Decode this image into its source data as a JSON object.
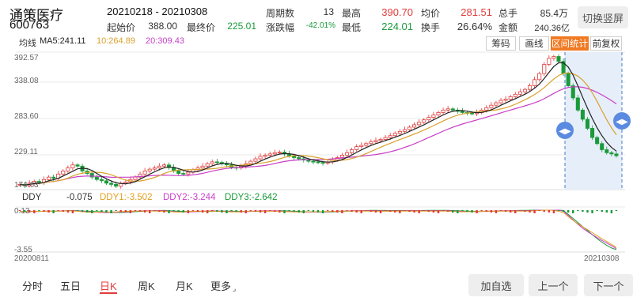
{
  "stock": {
    "name": "通策医疗",
    "code": "600763"
  },
  "summary": {
    "range": "20210218  - 20210308",
    "row1": [
      {
        "label": "周期数",
        "value": "13",
        "tone": "dark"
      },
      {
        "label": "最高",
        "value": "390.70",
        "tone": "red"
      },
      {
        "label": "均价",
        "value": "281.51",
        "tone": "red"
      },
      {
        "label": "总手",
        "value": "85.4万",
        "tone": "dark"
      }
    ],
    "row2": [
      {
        "label": "起始价",
        "value": "388.00",
        "tone": "dark"
      },
      {
        "label": "最终价",
        "value": "225.01",
        "tone": "green"
      },
      {
        "label": "涨跌幅",
        "value": "-42.01%",
        "tone": "green"
      },
      {
        "label": "最低",
        "value": "224.01",
        "tone": "green"
      },
      {
        "label": "换手",
        "value": "26.64%",
        "tone": "dark"
      },
      {
        "label": "金额",
        "value": "240.36亿",
        "tone": "dark"
      }
    ],
    "switch_label": "切换竖屏"
  },
  "ma": {
    "label": "均线",
    "ma5": "MA5:241.11",
    "ma10": "10:264.89",
    "ma20": "20:309.43",
    "colors": {
      "ma5": "#222222",
      "ma10": "#d9a12b",
      "ma20": "#c83fc8"
    }
  },
  "toolbar": [
    "筹码",
    "画线",
    "区间统计",
    "前复权"
  ],
  "toolbar_active": "区间统计",
  "price_axis": [
    "392.57",
    "338.08",
    "283.60",
    "229.11",
    "174.63"
  ],
  "ddy": {
    "name": "DDY",
    "value": "-0.075",
    "ddy1": "DDY1:-3.502",
    "ddy2": "DDY2:-3.244",
    "ddy3": "DDY3:-2.642",
    "axis_top": "0.13",
    "axis_bottom": "-3.55",
    "colors": {
      "ddy1": "#e0a020",
      "ddy2": "#c83fc8",
      "ddy3": "#1a9a3a"
    }
  },
  "dates": {
    "start": "20200811",
    "end": "20210308"
  },
  "tabs": [
    "分时",
    "五日",
    "日K",
    "周K",
    "月K",
    "更多"
  ],
  "tab_active": "日K",
  "buttons": {
    "add": "加自选",
    "prev": "上一个",
    "next": "下一个"
  },
  "chart_data": {
    "type": "candlestick",
    "x_start": "20200811",
    "x_end": "20210308",
    "ylim": [
      174.63,
      392.57
    ],
    "close_approx": [
      178,
      176,
      180,
      183,
      181,
      186,
      190,
      188,
      195,
      200,
      205,
      210,
      208,
      200,
      196,
      190,
      186,
      184,
      180,
      178,
      175,
      180,
      182,
      186,
      190,
      195,
      200,
      203,
      205,
      208,
      210,
      206,
      200,
      196,
      195,
      198,
      202,
      205,
      208,
      212,
      215,
      214,
      212,
      210,
      206,
      205,
      208,
      212,
      216,
      220,
      224,
      226,
      228,
      230,
      231,
      228,
      225,
      222,
      220,
      218,
      216,
      215,
      214,
      213,
      215,
      218,
      222,
      226,
      230,
      235,
      240,
      242,
      245,
      248,
      250,
      252,
      255,
      258,
      262,
      265,
      268,
      272,
      276,
      280,
      284,
      288,
      292,
      296,
      300,
      302,
      300,
      298,
      296,
      295,
      294,
      296,
      300,
      304,
      308,
      312,
      316,
      318,
      322,
      326,
      330,
      334,
      340,
      350,
      360,
      375,
      385,
      388,
      380,
      360,
      340,
      320,
      300,
      285,
      270,
      255,
      245,
      235,
      230,
      228,
      225
    ],
    "ma5_last": 241.11,
    "ma10_last": 264.89,
    "ma20_last": 309.43,
    "interval_highlight": {
      "start": "20210218",
      "end": "20210308"
    }
  }
}
